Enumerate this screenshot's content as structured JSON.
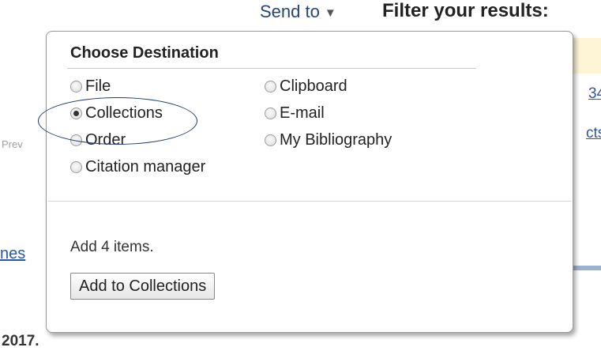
{
  "background": {
    "send_to_label": "Send to",
    "filter_title": "Filter your results:",
    "prev_label": "Prev",
    "right_link_1": "34",
    "right_link_2": "cts",
    "left_link": "nes",
    "year": "2017."
  },
  "popup": {
    "title": "Choose Destination",
    "options": [
      {
        "label": "File",
        "selected": false
      },
      {
        "label": "Clipboard",
        "selected": false
      },
      {
        "label": "Collections",
        "selected": true
      },
      {
        "label": "E-mail",
        "selected": false
      },
      {
        "label": "Order",
        "selected": false
      },
      {
        "label": "My Bibliography",
        "selected": false
      },
      {
        "label": "Citation manager",
        "selected": false
      }
    ],
    "add_text": "Add 4 items.",
    "add_button_label": "Add to Collections"
  },
  "colors": {
    "link": "#2b56a8",
    "highlight": "#223a6c"
  }
}
